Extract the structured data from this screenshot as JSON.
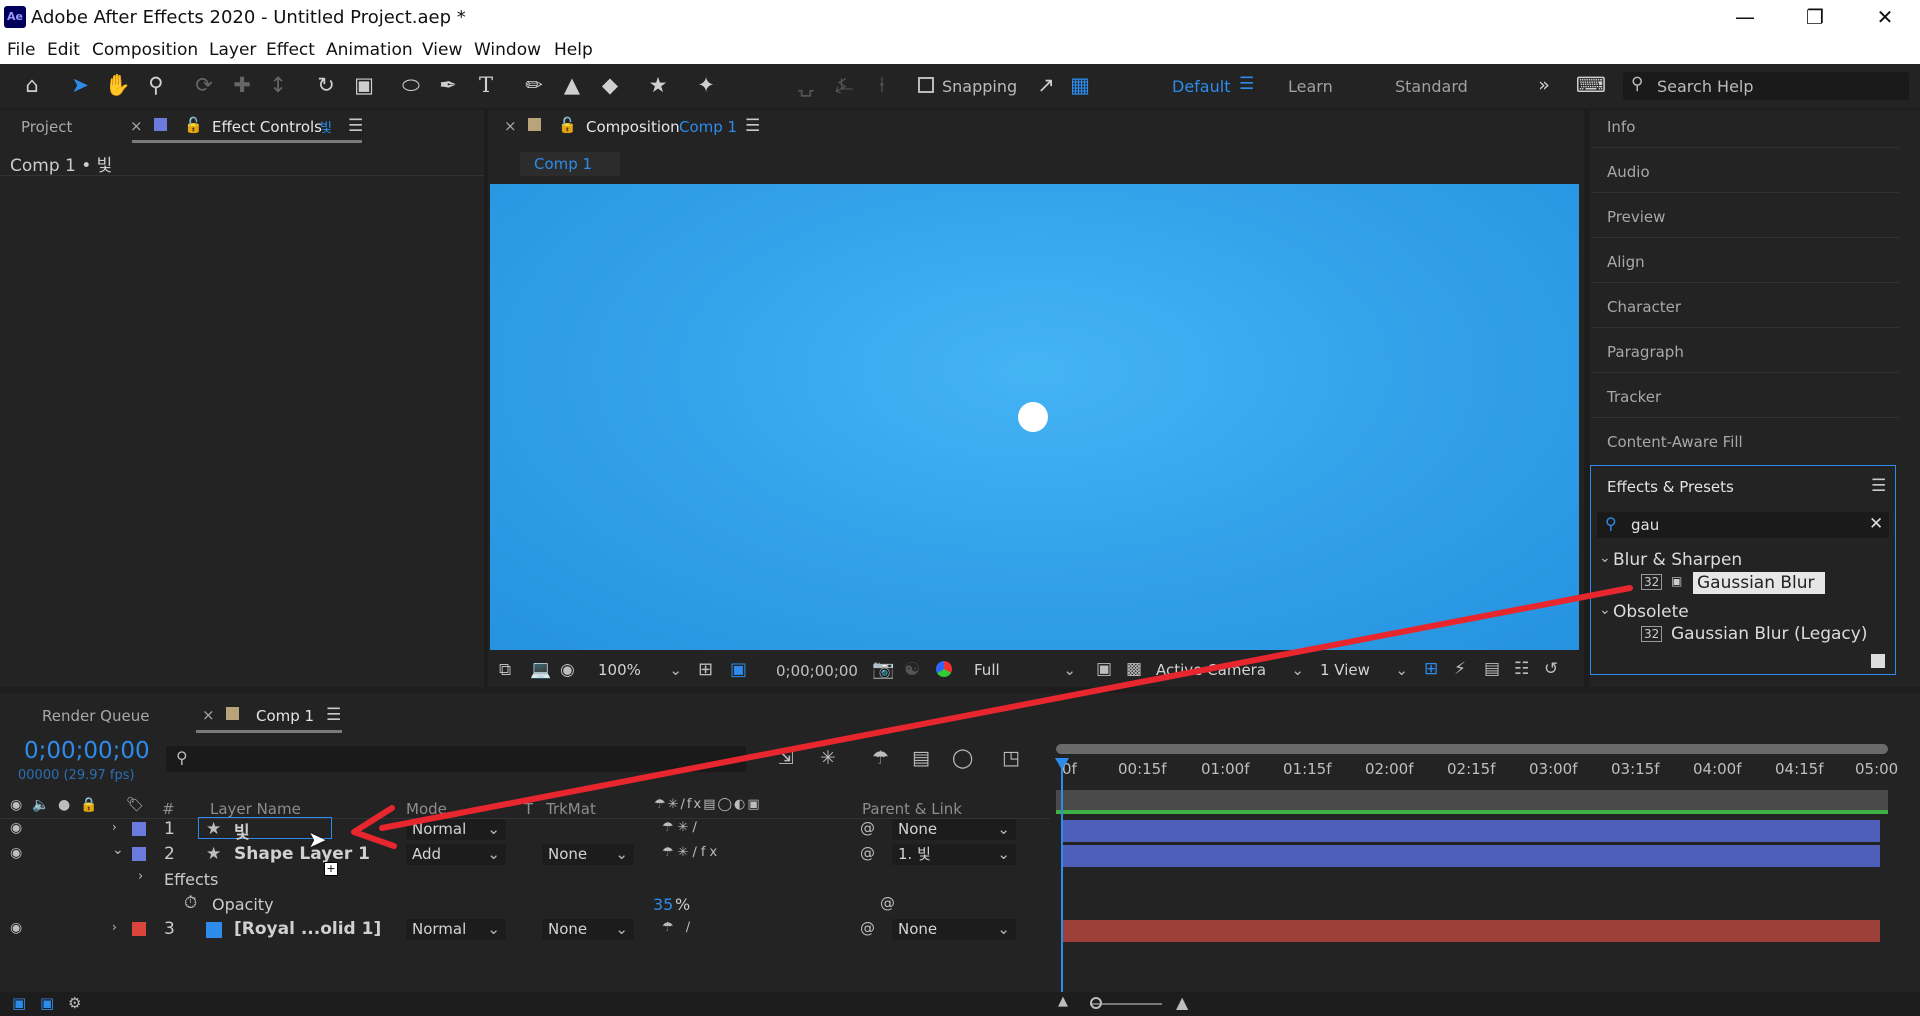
{
  "titlebar": {
    "app_icon": "Ae",
    "title": "Adobe After Effects 2020 - Untitled Project.aep *"
  },
  "menu": [
    "File",
    "Edit",
    "Composition",
    "Layer",
    "Effect",
    "Animation",
    "View",
    "Window",
    "Help"
  ],
  "toolbar": {
    "snapping_label": "Snapping",
    "workspaces": {
      "default": "Default",
      "learn": "Learn",
      "standard": "Standard"
    },
    "search_placeholder": "Search Help",
    "accent": "#2d8ceb"
  },
  "project_panel": {
    "tab_project": "Project",
    "tab_effect_controls": "Effect Controls",
    "effect_controls_layer": "빛",
    "breadcrumb": "Comp 1 • 빛"
  },
  "composition_panel": {
    "tab_label": "Composition",
    "comp_name": "Comp 1",
    "sub_tab": "Comp 1",
    "canvas_color": "#3aa8ee",
    "zoom": "100%",
    "timecode": "0;00;00;00",
    "resolution": "Full",
    "camera": "Active Camera",
    "views": "1 View"
  },
  "right_panel": {
    "items": [
      "Info",
      "Audio",
      "Preview",
      "Align",
      "Character",
      "Paragraph",
      "Tracker",
      "Content-Aware Fill"
    ],
    "effects_presets": {
      "title": "Effects & Presets",
      "search_value": "gau",
      "groups": [
        {
          "name": "Blur & Sharpen",
          "items": [
            {
              "badge": "32",
              "label": "Gaussian Blur",
              "selected": true
            }
          ]
        },
        {
          "name": "Obsolete",
          "items": [
            {
              "badge": "32",
              "label": "Gaussian Blur (Legacy)",
              "selected": false
            }
          ]
        }
      ]
    }
  },
  "timeline": {
    "tab_render_queue": "Render Queue",
    "tab_comp": "Comp 1",
    "timecode": "0;00;00;00",
    "frame_info": "00000 (29.97 fps)",
    "columns": {
      "num": "#",
      "layer_name": "Layer Name",
      "mode": "Mode",
      "t": "T",
      "trkmat": "TrkMat",
      "parent": "Parent & Link"
    },
    "ruler": [
      "0f",
      "00:15f",
      "01:00f",
      "01:15f",
      "02:00f",
      "02:15f",
      "03:00f",
      "03:15f",
      "04:00f",
      "04:15f",
      "05:00"
    ],
    "layers": [
      {
        "index": "1",
        "name": "빛",
        "mode": "Normal",
        "trkmat": "",
        "parent": "None",
        "label_color": "#6b7bdc"
      },
      {
        "index": "2",
        "name": "Shape Layer 1",
        "mode": "Add",
        "trkmat": "None",
        "parent": "1. 빛",
        "label_color": "#6b7bdc"
      },
      {
        "index": "3",
        "name": "[Royal ...olid 1]",
        "mode": "Normal",
        "trkmat": "None",
        "parent": "None",
        "label_color": "#d9453a"
      }
    ],
    "effects_label": "Effects",
    "opacity_label": "Opacity",
    "opacity_value": "35",
    "opacity_unit": "%"
  }
}
